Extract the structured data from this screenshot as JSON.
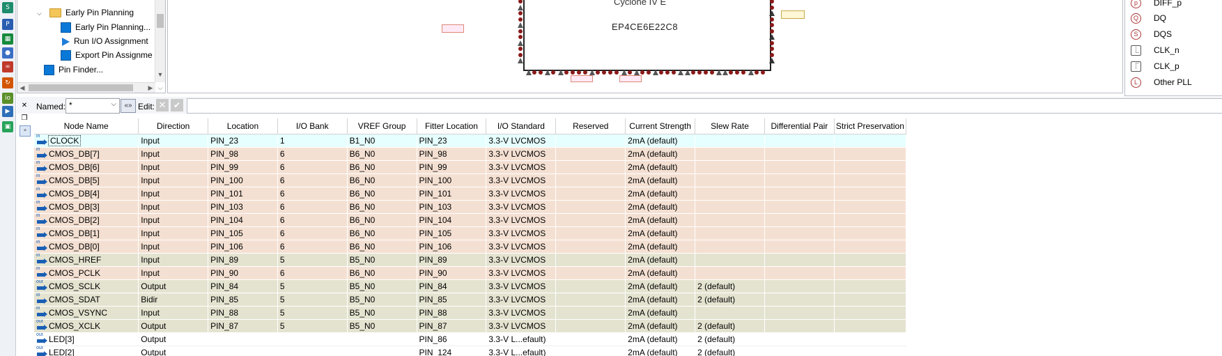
{
  "tasks": {
    "items": [
      {
        "label": "Early Pin Planning",
        "kind": "folder",
        "level": 1,
        "expanded": true
      },
      {
        "label": "Early Pin Planning...",
        "kind": "task",
        "level": 2
      },
      {
        "label": "Run I/O Assignment",
        "kind": "run",
        "level": 2
      },
      {
        "label": "Export Pin Assignme",
        "kind": "task",
        "level": 2
      },
      {
        "label": "Pin Finder...",
        "kind": "task",
        "level": 1
      }
    ]
  },
  "package": {
    "family": "Cyclone IV E",
    "device": "EP4CE6E22C8"
  },
  "legend": {
    "items": [
      {
        "glyph": "p",
        "label": "DIFF_p",
        "shape": "circle"
      },
      {
        "glyph": "Q",
        "label": "DQ",
        "shape": "circle"
      },
      {
        "glyph": "S",
        "label": "DQS",
        "shape": "circle"
      },
      {
        "glyph": "⎿",
        "label": "CLK_n",
        "shape": "square"
      },
      {
        "glyph": "⎾",
        "label": "CLK_p",
        "shape": "square"
      },
      {
        "glyph": "L",
        "label": "Other PLL",
        "shape": "circle"
      }
    ]
  },
  "filter": {
    "named_label": "Named:",
    "named_value": "*",
    "edit_label": "Edit:"
  },
  "table": {
    "columns": [
      "Node Name",
      "Direction",
      "Location",
      "I/O Bank",
      "VREF Group",
      "Fitter Location",
      "I/O Standard",
      "Reserved",
      "Current Strength",
      "Slew Rate",
      "Differential Pair",
      "Strict Preservation"
    ],
    "rows": [
      {
        "icon": "in",
        "name": "CLOCK",
        "direction": "Input",
        "location": "PIN_23",
        "bank": "1",
        "vref": "B1_N0",
        "fitter": "PIN_23",
        "standard": "3.3-V LVCMOS",
        "reserved": "",
        "strength": "2mA (default)",
        "slew": "",
        "diff": "",
        "strict": "",
        "style": "sel"
      },
      {
        "icon": "in",
        "name": "CMOS_DB[7]",
        "direction": "Input",
        "location": "PIN_98",
        "bank": "6",
        "vref": "B6_N0",
        "fitter": "PIN_98",
        "standard": "3.3-V LVCMOS",
        "reserved": "",
        "strength": "2mA (default)",
        "slew": "",
        "diff": "",
        "strict": "",
        "style": "b6"
      },
      {
        "icon": "in",
        "name": "CMOS_DB[6]",
        "direction": "Input",
        "location": "PIN_99",
        "bank": "6",
        "vref": "B6_N0",
        "fitter": "PIN_99",
        "standard": "3.3-V LVCMOS",
        "reserved": "",
        "strength": "2mA (default)",
        "slew": "",
        "diff": "",
        "strict": "",
        "style": "b6"
      },
      {
        "icon": "in",
        "name": "CMOS_DB[5]",
        "direction": "Input",
        "location": "PIN_100",
        "bank": "6",
        "vref": "B6_N0",
        "fitter": "PIN_100",
        "standard": "3.3-V LVCMOS",
        "reserved": "",
        "strength": "2mA (default)",
        "slew": "",
        "diff": "",
        "strict": "",
        "style": "b6"
      },
      {
        "icon": "in",
        "name": "CMOS_DB[4]",
        "direction": "Input",
        "location": "PIN_101",
        "bank": "6",
        "vref": "B6_N0",
        "fitter": "PIN_101",
        "standard": "3.3-V LVCMOS",
        "reserved": "",
        "strength": "2mA (default)",
        "slew": "",
        "diff": "",
        "strict": "",
        "style": "b6"
      },
      {
        "icon": "in",
        "name": "CMOS_DB[3]",
        "direction": "Input",
        "location": "PIN_103",
        "bank": "6",
        "vref": "B6_N0",
        "fitter": "PIN_103",
        "standard": "3.3-V LVCMOS",
        "reserved": "",
        "strength": "2mA (default)",
        "slew": "",
        "diff": "",
        "strict": "",
        "style": "b6"
      },
      {
        "icon": "in",
        "name": "CMOS_DB[2]",
        "direction": "Input",
        "location": "PIN_104",
        "bank": "6",
        "vref": "B6_N0",
        "fitter": "PIN_104",
        "standard": "3.3-V LVCMOS",
        "reserved": "",
        "strength": "2mA (default)",
        "slew": "",
        "diff": "",
        "strict": "",
        "style": "b6"
      },
      {
        "icon": "in",
        "name": "CMOS_DB[1]",
        "direction": "Input",
        "location": "PIN_105",
        "bank": "6",
        "vref": "B6_N0",
        "fitter": "PIN_105",
        "standard": "3.3-V LVCMOS",
        "reserved": "",
        "strength": "2mA (default)",
        "slew": "",
        "diff": "",
        "strict": "",
        "style": "b6"
      },
      {
        "icon": "in",
        "name": "CMOS_DB[0]",
        "direction": "Input",
        "location": "PIN_106",
        "bank": "6",
        "vref": "B6_N0",
        "fitter": "PIN_106",
        "standard": "3.3-V LVCMOS",
        "reserved": "",
        "strength": "2mA (default)",
        "slew": "",
        "diff": "",
        "strict": "",
        "style": "b6"
      },
      {
        "icon": "in",
        "name": "CMOS_HREF",
        "direction": "Input",
        "location": "PIN_89",
        "bank": "5",
        "vref": "B5_N0",
        "fitter": "PIN_89",
        "standard": "3.3-V LVCMOS",
        "reserved": "",
        "strength": "2mA (default)",
        "slew": "",
        "diff": "",
        "strict": "",
        "style": "b5"
      },
      {
        "icon": "in",
        "name": "CMOS_PCLK",
        "direction": "Input",
        "location": "PIN_90",
        "bank": "6",
        "vref": "B6_N0",
        "fitter": "PIN_90",
        "standard": "3.3-V LVCMOS",
        "reserved": "",
        "strength": "2mA (default)",
        "slew": "",
        "diff": "",
        "strict": "",
        "style": "b6"
      },
      {
        "icon": "out",
        "name": "CMOS_SCLK",
        "direction": "Output",
        "location": "PIN_84",
        "bank": "5",
        "vref": "B5_N0",
        "fitter": "PIN_84",
        "standard": "3.3-V LVCMOS",
        "reserved": "",
        "strength": "2mA (default)",
        "slew": "2 (default)",
        "diff": "",
        "strict": "",
        "style": "b5"
      },
      {
        "icon": "io",
        "name": "CMOS_SDAT",
        "direction": "Bidir",
        "location": "PIN_85",
        "bank": "5",
        "vref": "B5_N0",
        "fitter": "PIN_85",
        "standard": "3.3-V LVCMOS",
        "reserved": "",
        "strength": "2mA (default)",
        "slew": "2 (default)",
        "diff": "",
        "strict": "",
        "style": "b5"
      },
      {
        "icon": "in",
        "name": "CMOS_VSYNC",
        "direction": "Input",
        "location": "PIN_88",
        "bank": "5",
        "vref": "B5_N0",
        "fitter": "PIN_88",
        "standard": "3.3-V LVCMOS",
        "reserved": "",
        "strength": "2mA (default)",
        "slew": "",
        "diff": "",
        "strict": "",
        "style": "b5"
      },
      {
        "icon": "out",
        "name": "CMOS_XCLK",
        "direction": "Output",
        "location": "PIN_87",
        "bank": "5",
        "vref": "B5_N0",
        "fitter": "PIN_87",
        "standard": "3.3-V LVCMOS",
        "reserved": "",
        "strength": "2mA (default)",
        "slew": "2 (default)",
        "diff": "",
        "strict": "",
        "style": "b5"
      },
      {
        "icon": "out",
        "name": "LED[3]",
        "direction": "Output",
        "location": "",
        "bank": "",
        "vref": "",
        "fitter": "PIN_86",
        "standard": "3.3-V L...efault)",
        "reserved": "",
        "strength": "2mA (default)",
        "slew": "2 (default)",
        "diff": "",
        "strict": "",
        "style": "plain"
      },
      {
        "icon": "out",
        "name": "LED[2]",
        "direction": "Output",
        "location": "",
        "bank": "",
        "vref": "",
        "fitter": "PIN_124",
        "standard": "3.3-V L...efault)",
        "reserved": "",
        "strength": "2mA (default)",
        "slew": "2 (default)",
        "diff": "",
        "strict": "",
        "style": "plain"
      }
    ]
  },
  "colors": {
    "selected_row": "#e6ffff",
    "bank6_row": "#f4e0d2",
    "bank5_row": "#e4e3d0",
    "accent": "#1a5fb4",
    "pin_dot": "#8b1a1a"
  }
}
